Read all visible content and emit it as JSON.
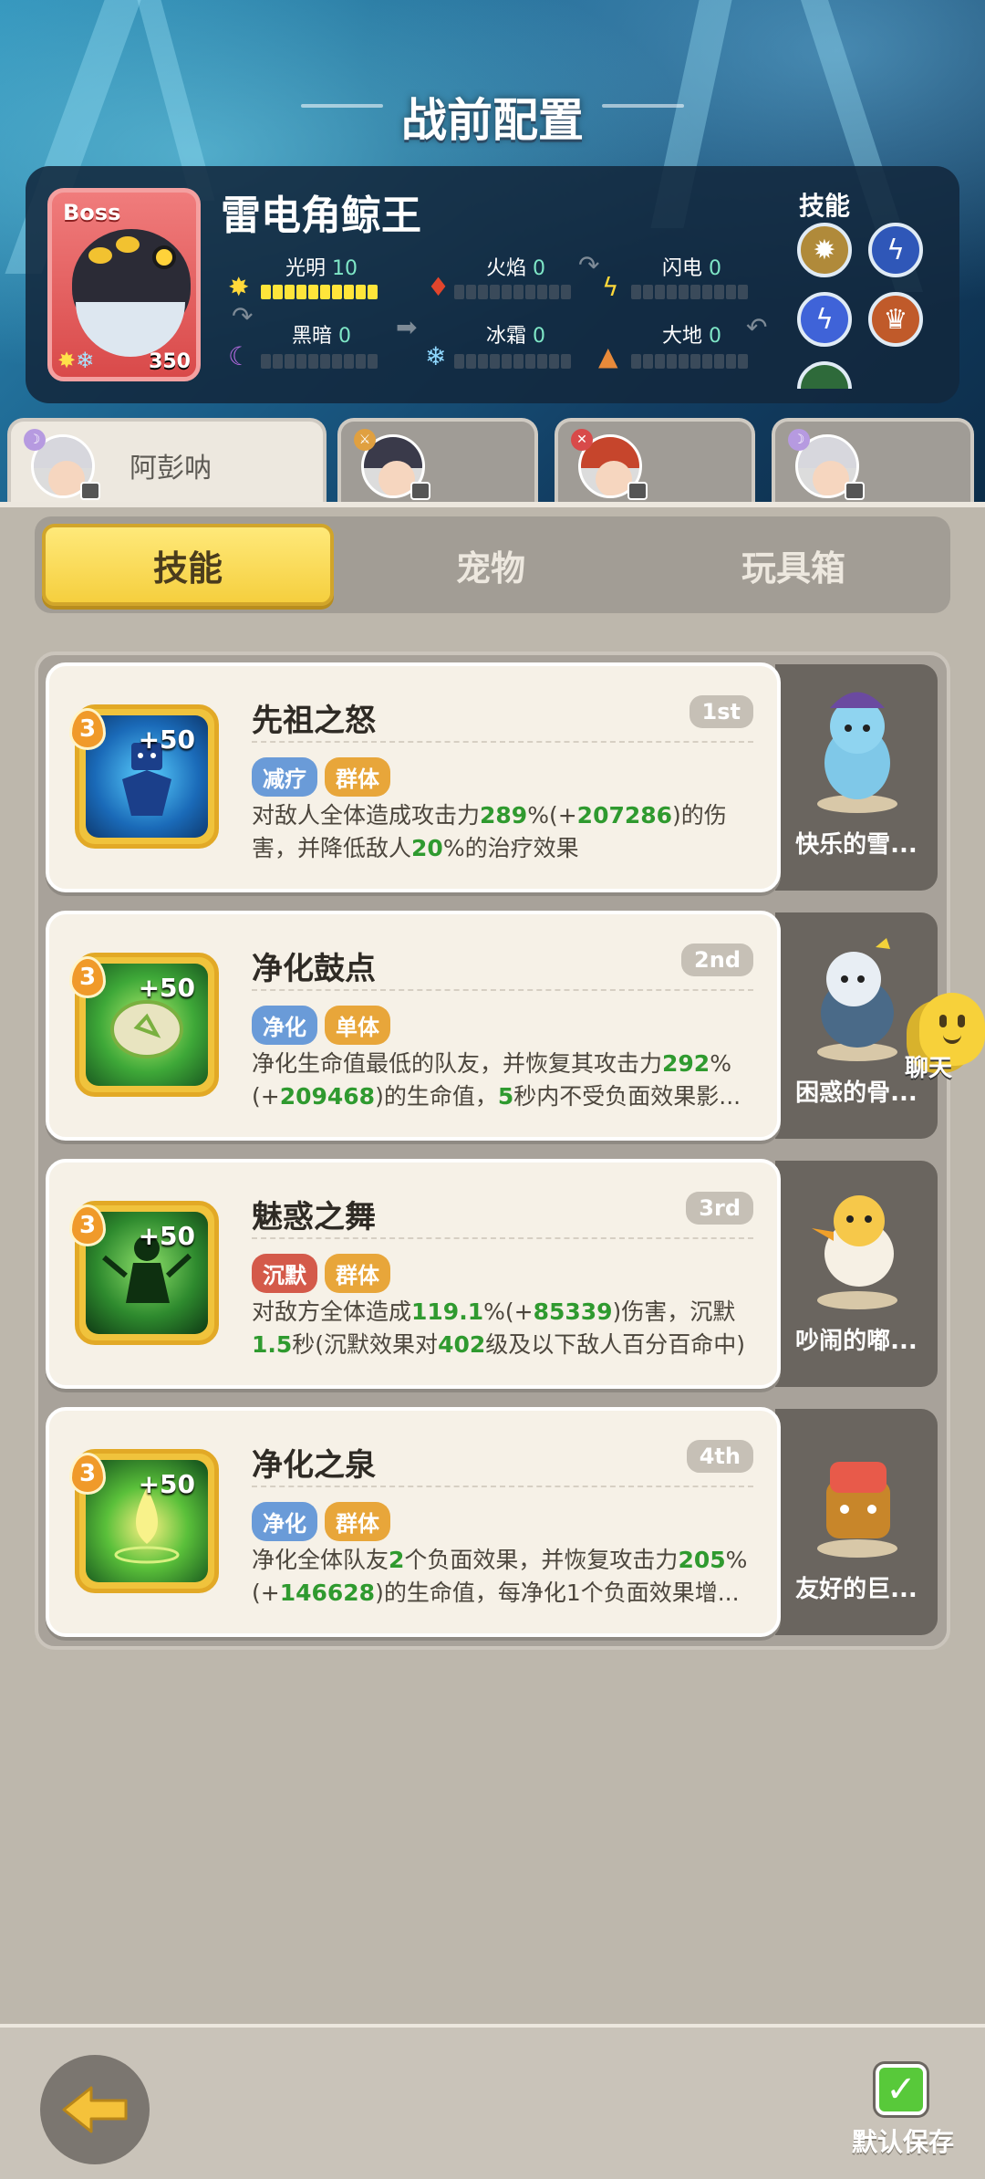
{
  "header": {
    "title": "战前配置"
  },
  "boss": {
    "tag": "Boss",
    "name": "雷电角鲸王",
    "level": "350",
    "elements": [
      {
        "name": "光明",
        "value": "10",
        "filled": 10,
        "icon": "sun-icon"
      },
      {
        "name": "火焰",
        "value": "0",
        "filled": 0,
        "icon": "fire-icon"
      },
      {
        "name": "闪电",
        "value": "0",
        "filled": 0,
        "icon": "lightning-icon"
      },
      {
        "name": "黑暗",
        "value": "0",
        "filled": 0,
        "icon": "moon-icon"
      },
      {
        "name": "冰霜",
        "value": "0",
        "filled": 0,
        "icon": "snowflake-icon"
      },
      {
        "name": "大地",
        "value": "0",
        "filled": 0,
        "icon": "mountain-icon"
      }
    ],
    "skills_label": "技能"
  },
  "hero_tabs": [
    {
      "name": "阿彭呐",
      "active": true
    },
    {
      "name": "",
      "active": false
    },
    {
      "name": "",
      "active": false
    },
    {
      "name": "",
      "active": false
    }
  ],
  "segments": {
    "skills": "技能",
    "pets": "宠物",
    "toybox": "玩具箱"
  },
  "skill_cards": [
    {
      "level": "3",
      "plus": "+50",
      "title": "先祖之怒",
      "rank": "1st",
      "tags": [
        {
          "label": "减疗",
          "color": "#6a9bd8"
        },
        {
          "label": "群体",
          "color": "#e8a63a"
        }
      ],
      "desc_parts": [
        "对敌人全体造成攻击力",
        "289",
        "%(+",
        "207286",
        ")的伤害，并降低敌人",
        "20",
        "%的治疗效果"
      ],
      "pet_name": "快乐的雪..."
    },
    {
      "level": "3",
      "plus": "+50",
      "title": "净化鼓点",
      "rank": "2nd",
      "tags": [
        {
          "label": "净化",
          "color": "#6a9bd8"
        },
        {
          "label": "单体",
          "color": "#e8a63a"
        }
      ],
      "desc_parts": [
        "净化生命值最低的队友，并恢复其攻击力",
        "292",
        "%(+",
        "209468",
        ")的生命值，",
        "5",
        "秒内不受负面效果影..."
      ],
      "pet_name": "困惑的骨..."
    },
    {
      "level": "3",
      "plus": "+50",
      "title": "魅惑之舞",
      "rank": "3rd",
      "tags": [
        {
          "label": "沉默",
          "color": "#d45a4a"
        },
        {
          "label": "群体",
          "color": "#e8a63a"
        }
      ],
      "desc_parts": [
        "对敌方全体造成",
        "119.1",
        "%(+",
        "85339",
        ")伤害，沉默",
        "1.5",
        "秒(沉默效果对",
        "402",
        "级及以下敌人百分百命中)"
      ],
      "pet_name": "吵闹的嘟..."
    },
    {
      "level": "3",
      "plus": "+50",
      "title": "净化之泉",
      "rank": "4th",
      "tags": [
        {
          "label": "净化",
          "color": "#6a9bd8"
        },
        {
          "label": "群体",
          "color": "#e8a63a"
        }
      ],
      "desc_parts": [
        "净化全体队友",
        "2",
        "个负面效果，并恢复攻击力",
        "205",
        "%(+",
        "146628",
        ")的生命值，每净化1个负面效果增..."
      ],
      "pet_name": "友好的巨..."
    }
  ],
  "chat": {
    "label": "聊天"
  },
  "footer": {
    "save_label": "默认保存"
  },
  "colors": {
    "accent": "#f5cf3e",
    "highlight": "#2f9a2f",
    "panel": "#12283e"
  }
}
